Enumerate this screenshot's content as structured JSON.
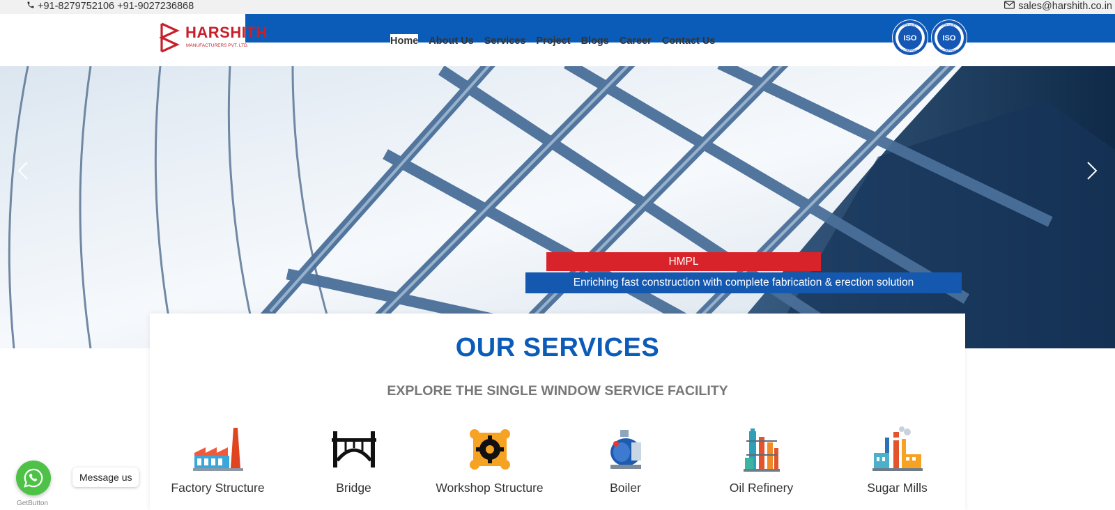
{
  "topbar": {
    "phone": "+91-8279752106 +91-9027236868",
    "email": "sales@harshith.co.in"
  },
  "logo": {
    "brand": "HARSHITH",
    "subtitle": "MANUFACTURERS PVT. LTD."
  },
  "nav": {
    "items": [
      {
        "label": "Home",
        "active": true
      },
      {
        "label": "About Us"
      },
      {
        "label": "Services"
      },
      {
        "label": "Project"
      },
      {
        "label": "Blogs"
      },
      {
        "label": "Career"
      },
      {
        "label": "Contact Us"
      }
    ]
  },
  "badges": [
    {
      "text": "ISO",
      "ring_top": "CERTIFIED",
      "ring_bottom": "COMPANY"
    },
    {
      "text": "ISO",
      "ring_top": "CERTIFIED",
      "ring_bottom": "COMPANY"
    }
  ],
  "hero": {
    "title": "HMPL",
    "subtitle": "Enriching fast construction with complete fabrication & erection solution"
  },
  "services": {
    "heading": "OUR SERVICES",
    "subheading": "EXPLORE THE SINGLE WINDOW SERVICE FACILITY",
    "items": [
      {
        "label": "Factory Structure",
        "icon": "factory-icon"
      },
      {
        "label": "Bridge",
        "icon": "bridge-icon"
      },
      {
        "label": "Workshop Structure",
        "icon": "workshop-gear-icon"
      },
      {
        "label": "Boiler",
        "icon": "boiler-icon"
      },
      {
        "label": "Oil Refinery",
        "icon": "refinery-icon"
      },
      {
        "label": "Sugar Mills",
        "icon": "sugar-mill-icon"
      }
    ]
  },
  "whatsapp": {
    "message_label": "Message us",
    "powered_by": "GetButton"
  },
  "colors": {
    "brand_blue": "#0b5cb8",
    "brand_red": "#d9232a",
    "whatsapp_green": "#4dc247"
  }
}
